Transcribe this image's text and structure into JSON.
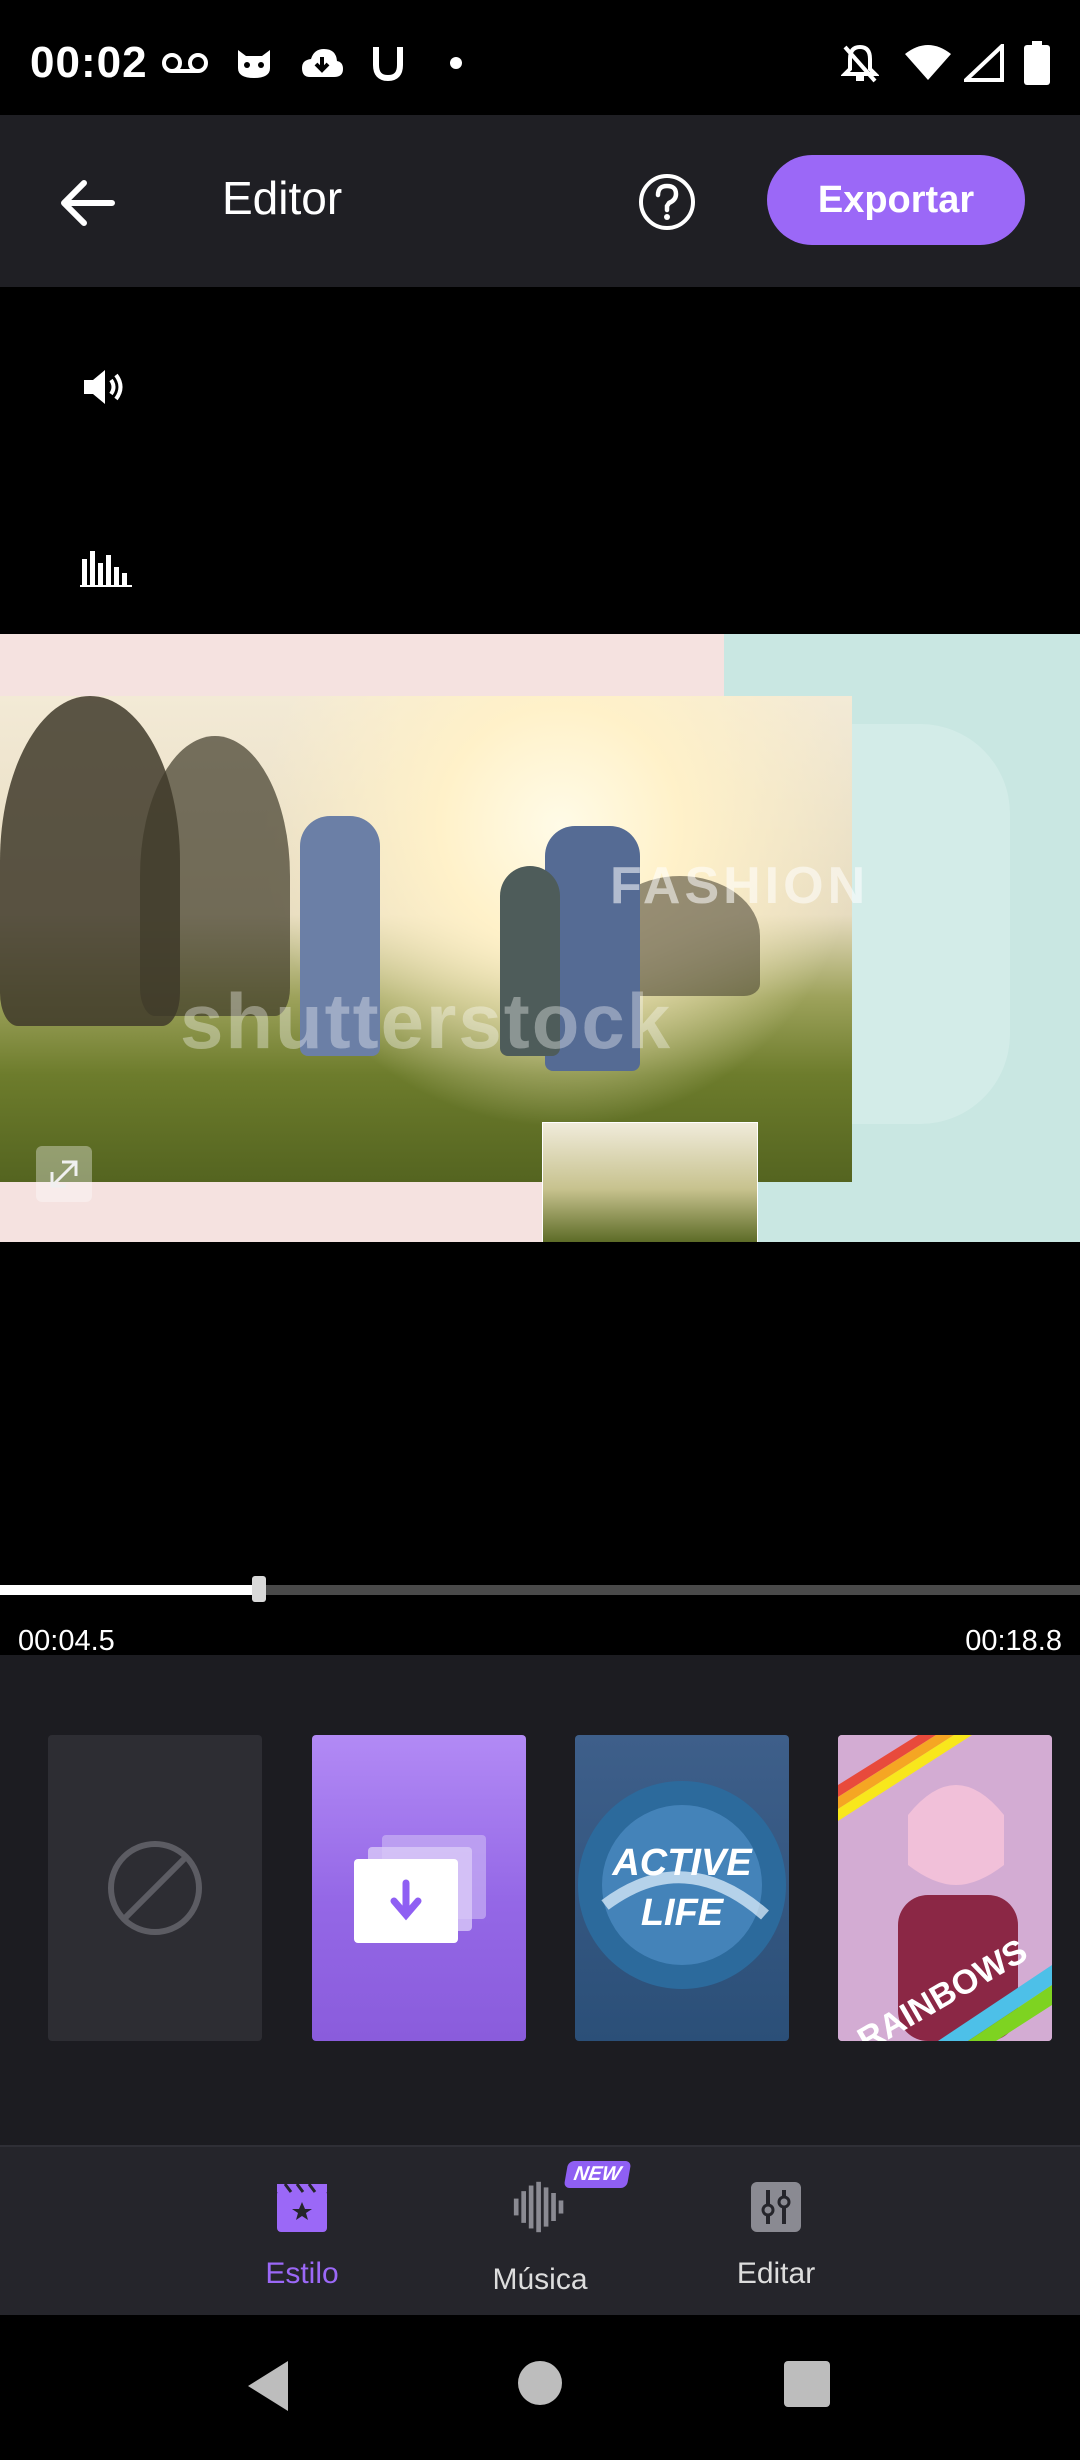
{
  "status_bar": {
    "time": "00:02",
    "left_icons": [
      "voicemail-icon",
      "cat-icon",
      "cloud-download-icon",
      "u-icon",
      "dot-icon"
    ],
    "right_icons": [
      "notifications-off-icon",
      "wifi-icon",
      "signal-icon",
      "battery-icon"
    ]
  },
  "header": {
    "title": "Editor",
    "export_label": "Exportar",
    "accent_color": "#9b68f7"
  },
  "preview": {
    "watermark": "shutterstock",
    "overlay_text": "FASHION"
  },
  "playback": {
    "current_time": "00:04.5",
    "total_time": "00:18.8",
    "progress": 0.24
  },
  "styles": [
    {
      "name": "none"
    },
    {
      "name": "download"
    },
    {
      "name": "active-life",
      "text": "ACTIVE LIFE"
    },
    {
      "name": "rainbows",
      "text": "RAINBOWS"
    }
  ],
  "tabs": [
    {
      "label": "Estilo",
      "active": true
    },
    {
      "label": "Música",
      "badge": "NEW"
    },
    {
      "label": "Editar"
    }
  ]
}
